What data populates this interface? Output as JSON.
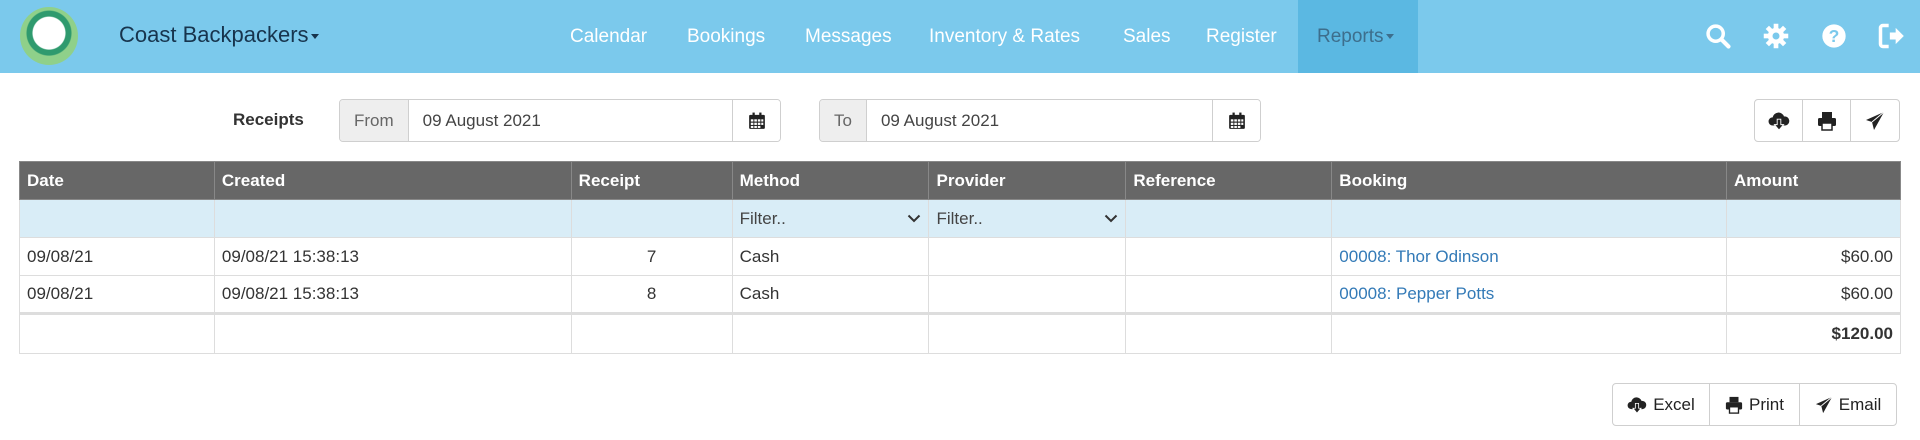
{
  "navbar": {
    "brand": "Coast Backpackers",
    "items": [
      {
        "label": "Calendar"
      },
      {
        "label": "Bookings"
      },
      {
        "label": "Messages"
      },
      {
        "label": "Inventory & Rates"
      },
      {
        "label": "Sales"
      },
      {
        "label": "Register"
      },
      {
        "label": "Reports"
      }
    ],
    "icons": [
      "search-icon",
      "gear-icon",
      "help-icon",
      "logout-icon"
    ]
  },
  "filters": {
    "title": "Receipts",
    "from_label": "From",
    "from_value": "09 August 2021",
    "to_label": "To",
    "to_value": "09 August 2021"
  },
  "table": {
    "columns": [
      "Date",
      "Created",
      "Receipt",
      "Method",
      "Provider",
      "Reference",
      "Booking",
      "Amount"
    ],
    "method_filter": "Filter..",
    "provider_filter": "Filter..",
    "rows": [
      {
        "date": "09/08/21",
        "created": "09/08/21 15:38:13",
        "receipt": "7",
        "method": "Cash",
        "provider": "",
        "reference": "",
        "booking": "00008: Thor Odinson",
        "amount": "$60.00"
      },
      {
        "date": "09/08/21",
        "created": "09/08/21 15:38:13",
        "receipt": "8",
        "method": "Cash",
        "provider": "",
        "reference": "",
        "booking": "00008: Pepper Potts",
        "amount": "$60.00"
      }
    ],
    "total": "$120.00"
  },
  "export": {
    "excel": "Excel",
    "print": "Print",
    "email": "Email"
  },
  "colors": {
    "navbar": "#7bc9ec",
    "navbar_active": "#5bb8e2",
    "header": "#676767",
    "filter_row": "#d9edf7",
    "link": "#337ab7"
  }
}
